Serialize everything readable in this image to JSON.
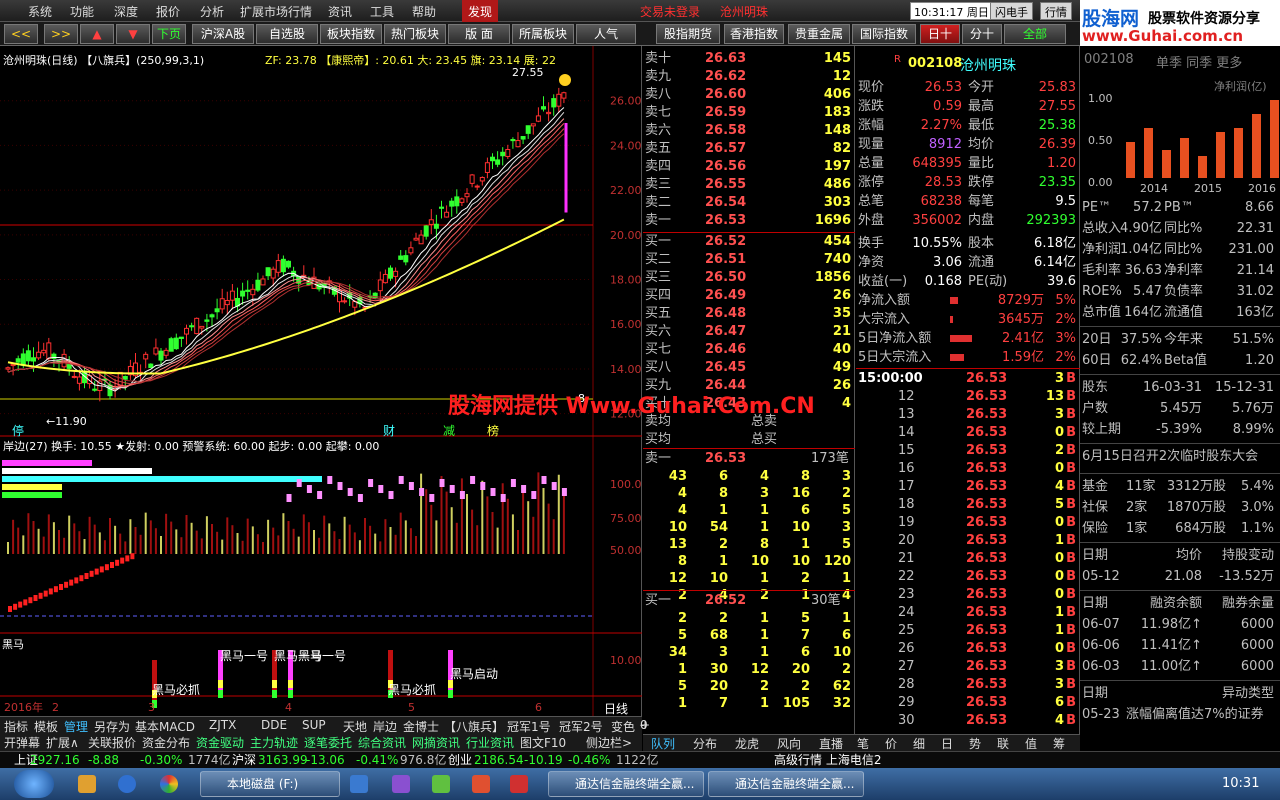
{
  "menu": {
    "items": [
      "系统",
      "功能",
      "深度",
      "报价",
      "分析",
      "扩展市场行情",
      "资讯",
      "工具",
      "帮助"
    ],
    "discover": "发现",
    "login_status": "交易未登录",
    "stock_name": "沧州明珠",
    "clock": "10:31:17 周日",
    "btn_flash": "闪电手",
    "btn_quote": "行情"
  },
  "toolbar": {
    "buttons": [
      "<<",
      ">>",
      "▲",
      "▼",
      "下页",
      "沪深A股",
      "自选股",
      "板块指数",
      "热门板块",
      "版 面",
      "所属板块",
      "人气",
      "股指期货",
      "香港指数",
      "贵重金属",
      "国际指数",
      "日十",
      "分十",
      "全部"
    ]
  },
  "chart": {
    "header": "沧州明珠(日线) 【八旗兵】(250,99,3,1)",
    "header2": "ZF: 23.78 【康熙帝】: 20.61  大: 23.45  旗: 23.14  展: 22",
    "price_axis": [
      "26.00",
      "24.00",
      "22.00",
      "20.00",
      "18.00",
      "16.00",
      "14.00",
      "12.00"
    ],
    "high_label": "27.55",
    "low_label": "←11.90",
    "mid_label": "8",
    "events": [
      "停",
      "财",
      "减",
      "榜"
    ],
    "ind1_header": "岸边(27) 换手: 10.55  ★发射: 0.00  预警系统: 60.00  起步: 0.00  起攀: 0.00",
    "ind1_axis": [
      "100.0",
      "75.00",
      "50.00"
    ],
    "ind2_label": "黑马",
    "ind2_axis": "10.00",
    "ind2_texts": [
      "黑马一号",
      "黑马一号",
      "黑马一号",
      "黑马必抓",
      "黑马必抓",
      "黑马启动"
    ],
    "date_labels": [
      "2016年",
      "2",
      "3",
      "4",
      "5",
      "6"
    ],
    "period": "日线"
  },
  "watermark": "股海网提供 Www.Guhai.Com.CN",
  "orderbook": {
    "sells": [
      [
        "卖十",
        "26.63",
        "145"
      ],
      [
        "卖九",
        "26.62",
        "12"
      ],
      [
        "卖八",
        "26.60",
        "406"
      ],
      [
        "卖七",
        "26.59",
        "183"
      ],
      [
        "卖六",
        "26.58",
        "148"
      ],
      [
        "卖五",
        "26.57",
        "82"
      ],
      [
        "卖四",
        "26.56",
        "197"
      ],
      [
        "卖三",
        "26.55",
        "486"
      ],
      [
        "卖二",
        "26.54",
        "303"
      ],
      [
        "卖一",
        "26.53",
        "1696"
      ]
    ],
    "buys": [
      [
        "买一",
        "26.52",
        "454"
      ],
      [
        "买二",
        "26.51",
        "740"
      ],
      [
        "买三",
        "26.50",
        "1856"
      ],
      [
        "买四",
        "26.49",
        "26"
      ],
      [
        "买五",
        "26.48",
        "35"
      ],
      [
        "买六",
        "26.47",
        "21"
      ],
      [
        "买七",
        "26.46",
        "40"
      ],
      [
        "买八",
        "26.45",
        "49"
      ],
      [
        "买九",
        "26.44",
        "26"
      ],
      [
        "买十",
        "26.43",
        "4"
      ]
    ],
    "avg": [
      [
        "卖均",
        "总卖"
      ],
      [
        "买均",
        "总买"
      ]
    ],
    "sell1_queue": {
      "label": "卖一",
      "price": "26.53",
      "count": "173笔",
      "rows": [
        [
          "43",
          "6",
          "4",
          "8",
          "3"
        ],
        [
          "4",
          "8",
          "3",
          "16",
          "2"
        ],
        [
          "4",
          "1",
          "1",
          "6",
          "5"
        ],
        [
          "10",
          "54",
          "1",
          "10",
          "3"
        ],
        [
          "13",
          "2",
          "8",
          "1",
          "5"
        ],
        [
          "8",
          "1",
          "10",
          "10",
          "120"
        ],
        [
          "12",
          "10",
          "1",
          "2",
          "1"
        ],
        [
          "2",
          "4",
          "2",
          "1",
          "4"
        ]
      ]
    },
    "buy1_queue": {
      "label": "买一",
      "price": "26.52",
      "count": "30笔",
      "rows": [
        [
          "2",
          "2",
          "1",
          "5",
          "1"
        ],
        [
          "5",
          "68",
          "1",
          "7",
          "6"
        ],
        [
          "34",
          "3",
          "1",
          "6",
          "10"
        ],
        [
          "1",
          "30",
          "12",
          "20",
          "2"
        ],
        [
          "5",
          "20",
          "2",
          "2",
          "62"
        ],
        [
          "1",
          "7",
          "1",
          "105",
          "32"
        ]
      ]
    }
  },
  "info": {
    "badge": "R",
    "code": "002108",
    "name": "沧州明珠",
    "rows": [
      [
        "现价",
        "26.53",
        "今开",
        "25.83"
      ],
      [
        "涨跌",
        "0.59",
        "最高",
        "27.55"
      ],
      [
        "涨幅",
        "2.27%",
        "最低",
        "25.38"
      ],
      [
        "现量",
        "8912",
        "均价",
        "26.39"
      ],
      [
        "总量",
        "648395",
        "量比",
        "1.20"
      ],
      [
        "涨停",
        "28.53",
        "跌停",
        "23.35"
      ],
      [
        "总笔",
        "68238",
        "每笔",
        "9.5"
      ],
      [
        "外盘",
        "356002",
        "内盘",
        "292393"
      ],
      [
        "换手",
        "10.55%",
        "股本",
        "6.18亿"
      ],
      [
        "净资",
        "3.06",
        "流通",
        "6.14亿"
      ],
      [
        "收益(一)",
        "0.168",
        "PE(动)",
        "39.6"
      ]
    ],
    "flows": [
      [
        "净流入额",
        "8729万",
        "5%"
      ],
      [
        "大宗流入",
        "3645万",
        "2%"
      ],
      [
        "5日净流入额",
        "2.41亿",
        "3%"
      ],
      [
        "5日大宗流入",
        "1.59亿",
        "2%"
      ]
    ],
    "ticks_time": "15:00:00",
    "ticks": [
      [
        "12",
        "26.53",
        "13",
        "B"
      ],
      [
        "13",
        "26.53",
        "3",
        "B"
      ],
      [
        "14",
        "26.53",
        "0",
        "B"
      ],
      [
        "15",
        "26.53",
        "2",
        "B"
      ],
      [
        "16",
        "26.53",
        "0",
        "B"
      ],
      [
        "17",
        "26.53",
        "4",
        "B"
      ],
      [
        "18",
        "26.53",
        "5",
        "B"
      ],
      [
        "19",
        "26.53",
        "0",
        "B"
      ],
      [
        "20",
        "26.53",
        "1",
        "B"
      ],
      [
        "21",
        "26.53",
        "0",
        "B"
      ],
      [
        "22",
        "26.53",
        "0",
        "B"
      ],
      [
        "23",
        "26.53",
        "0",
        "B"
      ],
      [
        "24",
        "26.53",
        "1",
        "B"
      ],
      [
        "25",
        "26.53",
        "1",
        "B"
      ],
      [
        "26",
        "26.53",
        "0",
        "B"
      ],
      [
        "27",
        "26.53",
        "3",
        "B"
      ],
      [
        "28",
        "26.53",
        "3",
        "B"
      ],
      [
        "29",
        "26.53",
        "6",
        "B"
      ],
      [
        "30",
        "26.53",
        "4",
        "B"
      ]
    ],
    "first_tick": [
      "26.53",
      "3",
      "B"
    ]
  },
  "ad": {
    "logo": "股海网",
    "tagline": "股票软件资源分享",
    "url": "www.Guhai.com.cn"
  },
  "fin": {
    "code": "002108",
    "tabs": "单季 同季 更多",
    "chart_title": "净利润(亿)",
    "years": [
      "2014",
      "2015",
      "2016"
    ],
    "yticks": [
      "1.00",
      "0.50",
      "0.00"
    ],
    "bars": [
      0.45,
      0.62,
      0.35,
      0.5,
      0.28,
      0.58,
      0.62,
      0.8,
      0.98
    ],
    "rows": [
      [
        "PE™",
        "57.2",
        "PB™",
        "8.66"
      ],
      [
        "总收入",
        "4.90亿",
        "同比%",
        "22.31"
      ],
      [
        "净利润",
        "1.04亿",
        "同比%",
        "231.00"
      ],
      [
        "毛利率",
        "36.63",
        "净利率",
        "21.14"
      ],
      [
        "ROE%",
        "5.47",
        "负债率",
        "31.02"
      ],
      [
        "总市值",
        "164亿",
        "流通值",
        "163亿"
      ]
    ],
    "perf": [
      [
        "20日",
        "37.5%",
        "今年来",
        "51.5%"
      ],
      [
        "60日",
        "62.4%",
        "Beta值",
        "1.20"
      ]
    ],
    "holders": [
      [
        "股东",
        "16-03-31",
        "15-12-31"
      ],
      [
        "户数",
        "5.45万",
        "5.76万"
      ],
      [
        "较上期",
        "-5.39%",
        "8.99%"
      ]
    ],
    "meeting": "6月15日召开2次临时股东大会",
    "inst": [
      [
        "基金",
        "11家",
        "3312万股",
        "5.4%"
      ],
      [
        "社保",
        "2家",
        "1870万股",
        "3.0%"
      ],
      [
        "保险",
        "1家",
        "684万股",
        "1.1%"
      ]
    ],
    "change_hdr": [
      "日期",
      "均价",
      "持股变动"
    ],
    "change": [
      "05-12",
      "21.08",
      "-13.52万"
    ],
    "margin_hdr": [
      "日期",
      "融资余额",
      "融券余量"
    ],
    "margin": [
      [
        "06-07",
        "11.98亿↑",
        "6000"
      ],
      [
        "06-06",
        "11.41亿↑",
        "6000"
      ],
      [
        "06-03",
        "11.00亿↑",
        "6000"
      ]
    ],
    "abn_hdr": [
      "日期",
      "异动类型"
    ],
    "abn": [
      "05-23",
      "涨幅偏离值达7%的证券"
    ]
  },
  "bottom_tabs1": [
    "指标",
    "模板",
    "管理",
    "另存为",
    "基本MACD",
    "ZJTX",
    "DDE",
    "SUP",
    "天地",
    "岸边",
    "金博士",
    "【八旗兵】",
    "冠军1号",
    "冠军2号",
    "变色K线",
    "+",
    "-",
    "0"
  ],
  "bottom_tabs2": [
    "开弹幕",
    "扩展∧",
    "关联报价",
    "资金分布",
    "资金驱动",
    "主力轨迹",
    "逐笔委托",
    "综合资讯",
    "网摘资讯",
    "行业资讯",
    "图文F10",
    "侧边栏>"
  ],
  "quote_tabs": [
    "队列",
    "分布",
    "龙虎",
    "风向",
    "直播",
    "笔",
    "价",
    "细",
    "日",
    "势",
    "联",
    "值",
    "筹"
  ],
  "status": {
    "sh_label": "上证",
    "sh": "2927.16",
    "sh_chg": "-8.88",
    "sh_pct": "-0.30%",
    "sh_amt": "1774亿",
    "hs_label": "沪深",
    "hs": "3163.99",
    "hs_chg": "-13.06",
    "hs_pct": "-0.41%",
    "hs_amt": "976.8亿",
    "cy_label": "创业",
    "cy": "2186.54",
    "cy_chg": "-10.19",
    "cy_pct": "-0.46%",
    "cy_amt": "1122亿",
    "feed": "高级行情 上海电信2"
  },
  "taskbar": {
    "disk": "本地磁盘 (F:)",
    "app1": "通达信金融终端全赢...",
    "app2": "通达信金融终端全赢...",
    "time": "10:31"
  }
}
